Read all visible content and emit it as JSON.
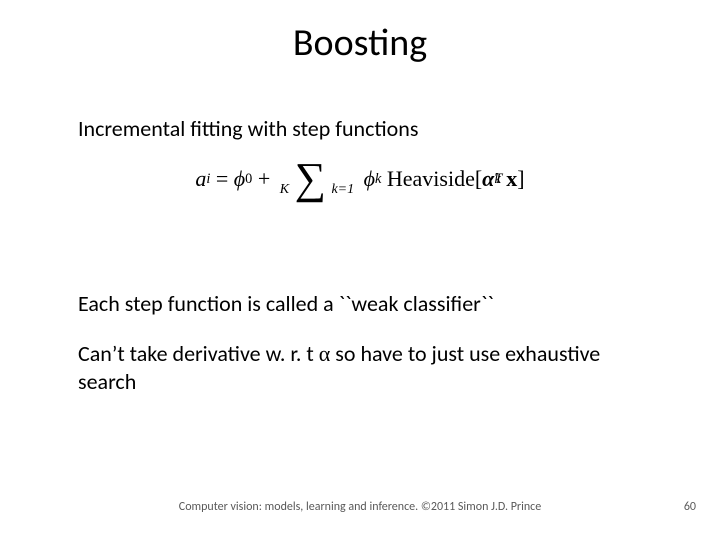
{
  "title": "Boosting",
  "line1": "Incremental fitting with step functions",
  "formula": {
    "lhs_var": "a",
    "lhs_sub": "i",
    "eq": " = ",
    "phi0_var": "ϕ",
    "phi0_sub": "0",
    "plus": " + ",
    "sum_upper": "K",
    "sum_lower": "k=1",
    "phik_var": "ϕ",
    "phik_sub": "k",
    "heaviside": "Heaviside",
    "lbrack": "[",
    "alpha_var": "α",
    "alpha_sup": "T",
    "alpha_sub": "k",
    "x_var": "x",
    "rbrack": "]"
  },
  "line2": "Each step function is called a ``weak classifier``",
  "line3a": "Can’t take derivative w. r. t ",
  "line3_alpha": "α",
  "line3b": " so have to just use exhaustive search",
  "footer": "Computer vision: models, learning and inference.  ©2011 Simon J.D. Prince",
  "page": "60"
}
